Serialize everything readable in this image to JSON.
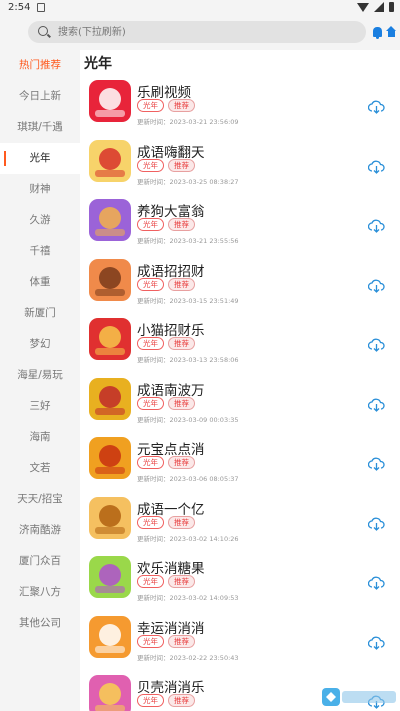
{
  "status_bar": {
    "time": "2:54"
  },
  "search": {
    "placeholder": "搜索(下拉刷新)"
  },
  "sidebar": {
    "items": [
      {
        "label": "热门推荐",
        "state": "hot"
      },
      {
        "label": "今日上新",
        "state": ""
      },
      {
        "label": "琪琪/千遇",
        "state": ""
      },
      {
        "label": "光年",
        "state": "active"
      },
      {
        "label": "财神",
        "state": ""
      },
      {
        "label": "久游",
        "state": ""
      },
      {
        "label": "千禧",
        "state": ""
      },
      {
        "label": "体重",
        "state": ""
      },
      {
        "label": "新厦门",
        "state": ""
      },
      {
        "label": "梦幻",
        "state": ""
      },
      {
        "label": "海星/易玩",
        "state": ""
      },
      {
        "label": "三好",
        "state": ""
      },
      {
        "label": "海南",
        "state": ""
      },
      {
        "label": "文若",
        "state": ""
      },
      {
        "label": "天天/招宝",
        "state": ""
      },
      {
        "label": "济南酷游",
        "state": ""
      },
      {
        "label": "厦门众百",
        "state": ""
      },
      {
        "label": "汇聚八方",
        "state": ""
      },
      {
        "label": "其他公司",
        "state": ""
      }
    ]
  },
  "main": {
    "title": "光年",
    "apps": [
      {
        "name": "乐刷视频",
        "tag1": "光年",
        "tag2": "推荐",
        "update": "更新时间：2023-03-21 23:56:09",
        "icon_bg": "#e8243a",
        "icon_fg": "#ffffff",
        "icon_name": "play-icon"
      },
      {
        "name": "成语嗨翻天",
        "tag1": "光年",
        "tag2": "推荐",
        "update": "更新时间：2023-03-25 08:38:27",
        "icon_bg": "#f7d36a",
        "icon_fg": "#d8332a",
        "icon_name": "caishen-icon"
      },
      {
        "name": "养狗大富翁",
        "tag1": "光年",
        "tag2": "推荐",
        "update": "更新时间：2023-03-21 23:55:56",
        "icon_bg": "#9b63d8",
        "icon_fg": "#f3b04a",
        "icon_name": "dog-icon"
      },
      {
        "name": "成语招招财",
        "tag1": "光年",
        "tag2": "推荐",
        "update": "更新时间：2023-03-15 23:51:49",
        "icon_bg": "#f08a4a",
        "icon_fg": "#7a3a1a",
        "icon_name": "girl-icon"
      },
      {
        "name": "小猫招财乐",
        "tag1": "光年",
        "tag2": "推荐",
        "update": "更新时间：2023-03-13 23:58:06",
        "icon_bg": "#e03030",
        "icon_fg": "#f6c64a",
        "icon_name": "cat-icon"
      },
      {
        "name": "成语南波万",
        "tag1": "光年",
        "tag2": "推荐",
        "update": "更新时间：2023-03-09 00:03:35",
        "icon_bg": "#e8b020",
        "icon_fg": "#c02a2a",
        "icon_name": "god-icon"
      },
      {
        "name": "元宝点点消",
        "tag1": "光年",
        "tag2": "推荐",
        "update": "更新时间：2023-03-06 08:05:37",
        "icon_bg": "#f0a020",
        "icon_fg": "#c83010",
        "icon_name": "gold-ingot-icon"
      },
      {
        "name": "成语一个亿",
        "tag1": "光年",
        "tag2": "推荐",
        "update": "更新时间：2023-03-02 14:10:26",
        "icon_bg": "#f5c060",
        "icon_fg": "#b06010",
        "icon_name": "coin-icon"
      },
      {
        "name": "欢乐消糖果",
        "tag1": "光年",
        "tag2": "推荐",
        "update": "更新时间：2023-03-02 14:09:53",
        "icon_bg": "#9ad84a",
        "icon_fg": "#b050d0",
        "icon_name": "candy-icon"
      },
      {
        "name": "幸运消消消",
        "tag1": "光年",
        "tag2": "推荐",
        "update": "更新时间：2023-02-22 23:50:43",
        "icon_bg": "#f59a30",
        "icon_fg": "#ffffff",
        "icon_name": "tiger-icon"
      },
      {
        "name": "贝壳消消乐",
        "tag1": "光年",
        "tag2": "推荐",
        "update": "",
        "icon_bg": "#e060b0",
        "icon_fg": "#f8d050",
        "icon_name": "shell-icon"
      }
    ]
  },
  "colors": {
    "accent": "#ff5a1f",
    "tag": "#e84040",
    "download": "#2a8fd8",
    "search_icon": "#1a7fe0"
  }
}
